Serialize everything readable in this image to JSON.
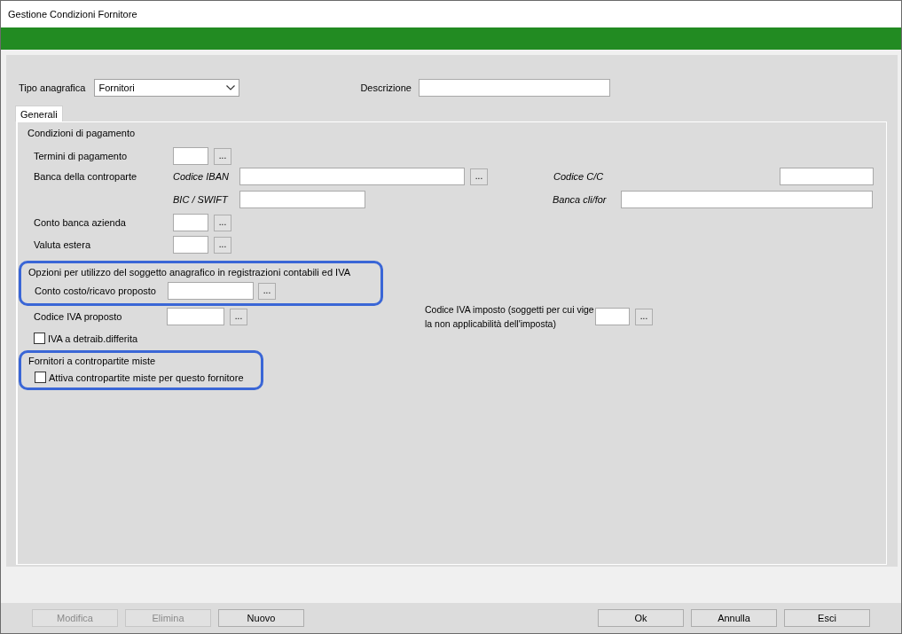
{
  "window": {
    "title": "Gestione Condizioni Fornitore"
  },
  "header": {
    "type_label": "Tipo anagrafica",
    "type_value": "Fornitori",
    "description_label": "Descrizione"
  },
  "tabs": [
    {
      "label": "Generali",
      "selected": true
    }
  ],
  "payment": {
    "heading": "Condizioni di pagamento",
    "terms_label": "Termini di pagamento",
    "terms_button": "...",
    "bank_label": "Banca della controparte",
    "iban_label": "Codice IBAN",
    "iban_button": "...",
    "cc_label": "Codice C/C",
    "bic_label": "BIC / SWIFT",
    "bank_name_label": "Banca cli/for",
    "company_account_label": "Conto banca azienda",
    "company_account_button": "...",
    "currency_label": "Valuta estera",
    "currency_button": "..."
  },
  "accounting_options": {
    "heading": "Opzioni per utilizzo del soggetto anagrafico in registrazioni contabili ed IVA",
    "highlighted": true,
    "cost_account_label": "Conto costo/ricavo proposto",
    "cost_account_button": "..."
  },
  "vat": {
    "proposed_label": "Codice IVA proposto",
    "proposed_button": "...",
    "imposed_label": "Codice IVA imposto (soggetti per cui vige la non applicabilità dell'imposta)",
    "imposed_button": "...",
    "deferred": {
      "label": "IVA a detraib.differita",
      "checked": false
    }
  },
  "mixed_accounts": {
    "heading": "Fornitori a contropartite miste",
    "highlighted": true,
    "activate": {
      "label": "Attiva contropartite miste per questo fornitore",
      "checked": false
    }
  },
  "buttons_left": [
    {
      "label": "Modifica",
      "disabled": true
    },
    {
      "label": "Elimina",
      "disabled": true
    },
    {
      "label": "Nuovo",
      "disabled": false
    }
  ],
  "buttons_right": [
    {
      "label": "Ok",
      "disabled": false
    },
    {
      "label": "Annulla",
      "disabled": false
    },
    {
      "label": "Esci",
      "disabled": false
    }
  ]
}
